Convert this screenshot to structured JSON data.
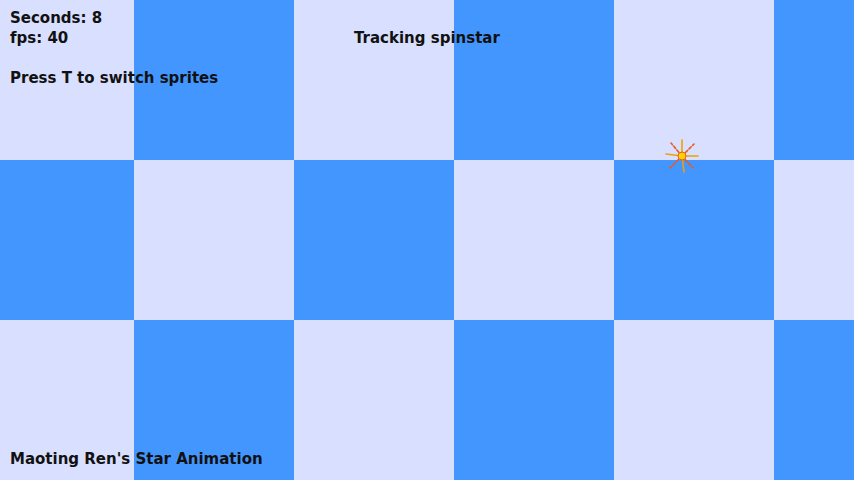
{
  "hud": {
    "seconds": "Seconds: 8",
    "fps": "fps: 40",
    "hint": "Press T to switch sprites"
  },
  "tracking": "Tracking spinstar",
  "footer": "Maoting Ren's Star Animation"
}
